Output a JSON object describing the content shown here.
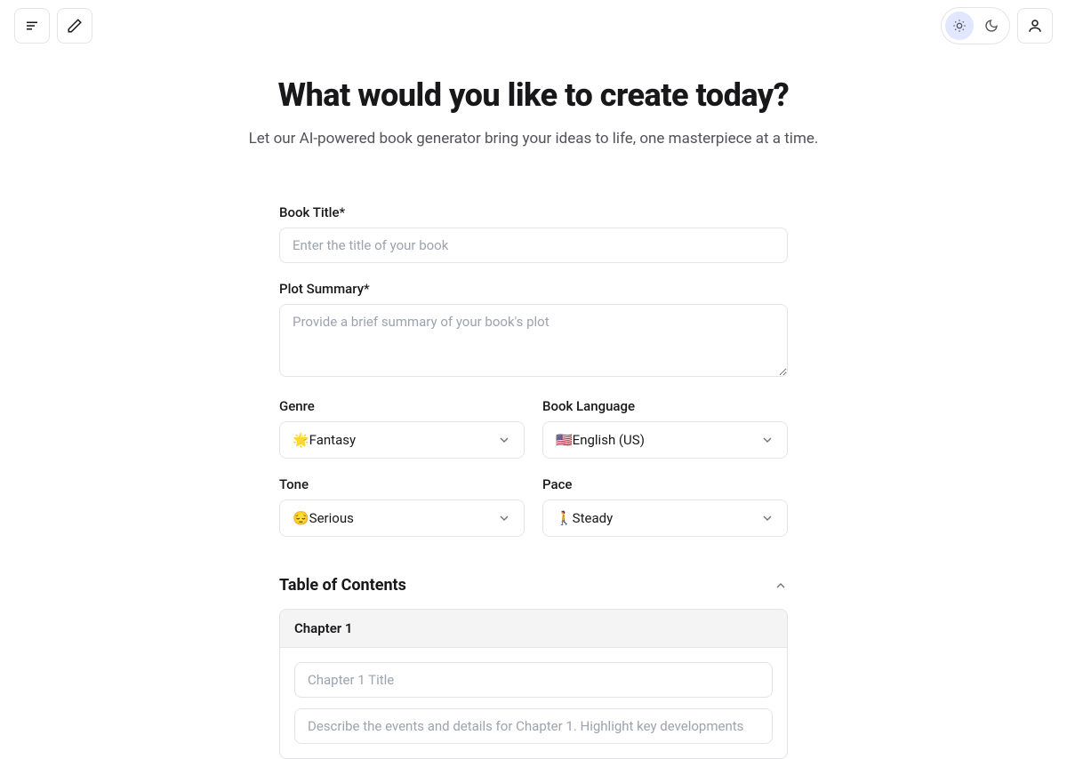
{
  "header": {
    "title": "What would you like to create today?",
    "subtitle": "Let our AI-powered book generator bring your ideas to life, one masterpiece at a time."
  },
  "form": {
    "bookTitle": {
      "label": "Book Title*",
      "placeholder": "Enter the title of your book",
      "value": ""
    },
    "plotSummary": {
      "label": "Plot Summary*",
      "placeholder": "Provide a brief summary of your book's plot",
      "value": ""
    },
    "genre": {
      "label": "Genre",
      "value": "🌟Fantasy"
    },
    "language": {
      "label": "Book Language",
      "value": "🇺🇸English (US)"
    },
    "tone": {
      "label": "Tone",
      "value": "😔Serious"
    },
    "pace": {
      "label": "Pace",
      "value": "🚶Steady"
    }
  },
  "toc": {
    "heading": "Table of Contents",
    "chapters": [
      {
        "heading": "Chapter 1",
        "titlePlaceholder": "Chapter 1 Title",
        "descPlaceholder": "Describe the events and details for Chapter 1. Highlight key developments"
      }
    ]
  }
}
